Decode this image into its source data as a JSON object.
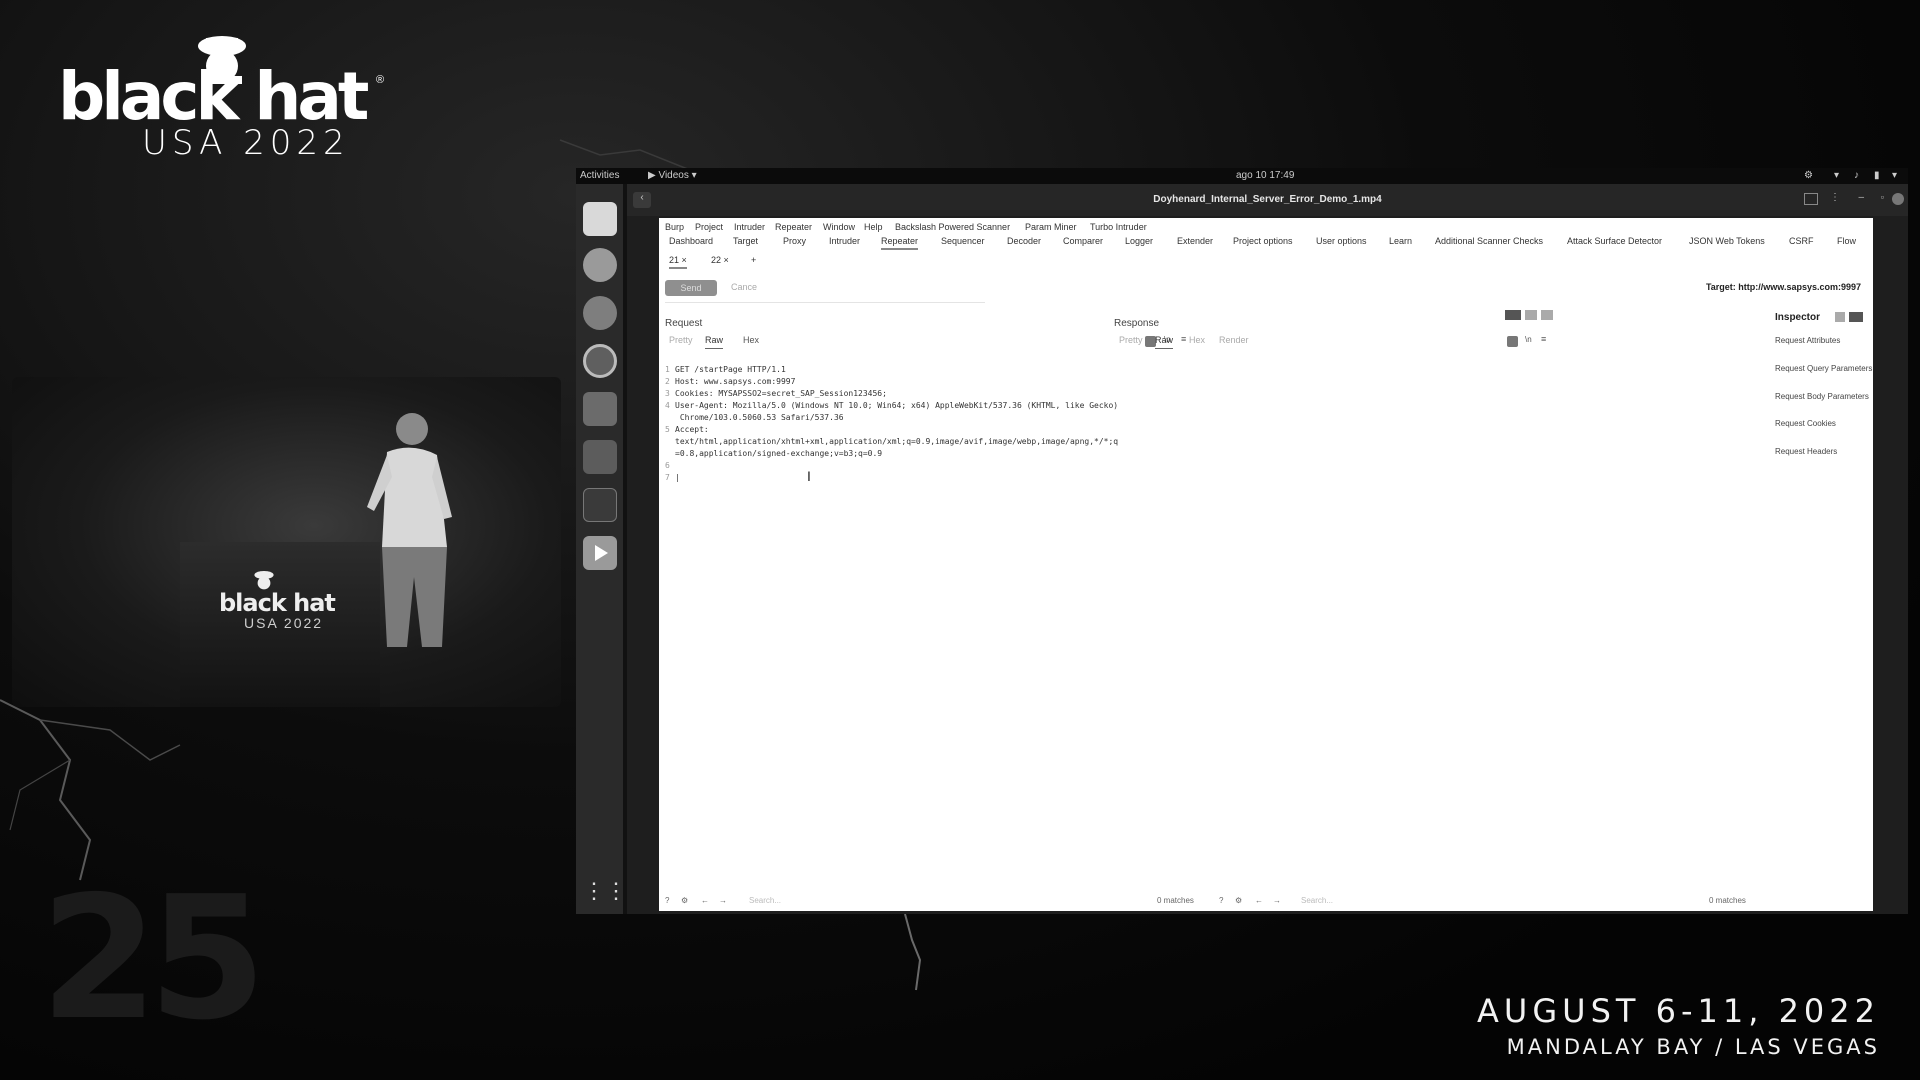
{
  "conference": {
    "logo_word": "black hat",
    "logo_sub": "USA 2022",
    "dates": "AUGUST 6-11, 2022",
    "venue": "MANDALAY BAY / LAS VEGAS"
  },
  "podium": {
    "logo_word": "black hat",
    "logo_sub": "USA 2022"
  },
  "desktop": {
    "activities": "Activities",
    "app_menu": "▶ Videos ▾",
    "clock": "ago 10  17:49",
    "window_title": "Doyhenard_Internal_Server_Error_Demo_1.mp4"
  },
  "burp": {
    "menu": [
      "Burp",
      "Project",
      "Intruder",
      "Repeater",
      "Window",
      "Help",
      "Backslash Powered Scanner",
      "Param Miner",
      "Turbo Intruder"
    ],
    "tools": [
      "Dashboard",
      "Target",
      "Proxy",
      "Intruder",
      "Repeater",
      "Sequencer",
      "Decoder",
      "Comparer",
      "Logger",
      "Extender",
      "Project options",
      "User options",
      "Learn",
      "Additional Scanner Checks",
      "Attack Surface Detector",
      "JSON Web Tokens",
      "CSRF",
      "Flow"
    ],
    "active_tool": "Repeater",
    "subtabs": [
      "21 ×",
      "22 ×",
      "+"
    ],
    "send_label": "Send",
    "cancel_label": "Cance",
    "target": "Target: http://www.sapsys.com:9997",
    "request": {
      "title": "Request",
      "modes": [
        "Pretty",
        "Raw",
        "Hex"
      ],
      "lines": [
        {
          "n": "1",
          "text": "GET /startPage HTTP/1.1"
        },
        {
          "n": "2",
          "text": "Host: www.sapsys.com:9997"
        },
        {
          "n": "3",
          "text": "Cookies: MYSAPSSO2=secret_SAP_Session123456;"
        },
        {
          "n": "4",
          "text": "User-Agent: Mozilla/5.0 (Windows NT 10.0; Win64; x64) AppleWebKit/537.36 (KHTML, like Gecko)"
        },
        {
          "n": "",
          "text": " Chrome/103.0.5060.53 Safari/537.36"
        },
        {
          "n": "5",
          "text": "Accept:"
        },
        {
          "n": "",
          "text": "text/html,application/xhtml+xml,application/xml;q=0.9,image/avif,image/webp,image/apng,*/*;q"
        },
        {
          "n": "",
          "text": "=0.8,application/signed-exchange;v=b3;q=0.9"
        },
        {
          "n": "6",
          "text": ""
        },
        {
          "n": "7",
          "text": "|"
        }
      ],
      "search_placeholder": "Search...",
      "matches": "0 matches"
    },
    "response": {
      "title": "Response",
      "modes": [
        "Pretty",
        "Raw",
        "Hex",
        "Render"
      ],
      "search_placeholder": "Search...",
      "matches": "0 matches"
    },
    "inspector": {
      "title": "Inspector",
      "items": [
        "Request Attributes",
        "Request Query Parameters",
        "Request Body Parameters",
        "Request Cookies",
        "Request Headers"
      ]
    }
  }
}
